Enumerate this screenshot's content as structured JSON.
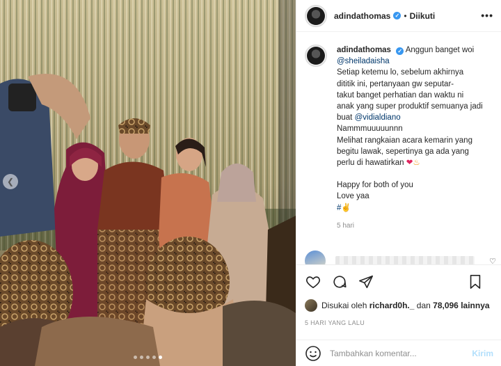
{
  "post": {
    "username": "adindathomas",
    "follow_status": "Diikuti",
    "separator": "•",
    "more_icon": "more-horizontal-icon"
  },
  "caption": {
    "username": "adindathomas",
    "lines": [
      "Anggun banget woi",
      "@sheiladaisha",
      "Setiap ketemu lo, sebelum akhirnya",
      "dititik ini, pertanyaan gw seputar-",
      "takut banget perhatian dan waktu ni",
      "anak yang super produktif semuanya jadi",
      "buat",
      "@vidialdiano",
      "Nammmuuuuunnn",
      "Melihat rangkaian acara kemarin yang",
      "begitu lawak, sepertinya ga ada yang",
      "perlu di hawatirkan",
      "Happy for both of you",
      "Love yaa",
      "#"
    ],
    "time": "5 hari"
  },
  "likes": {
    "prefix": "Disukai oleh",
    "user": "richard0h._",
    "connector": "dan",
    "count": "78,096",
    "suffix": "lainnya"
  },
  "timestamp": "5 HARI YANG LALU",
  "add_comment": {
    "placeholder": "Tambahkan komentar...",
    "send_label": "Kirim"
  },
  "carousel": {
    "total": 5,
    "active": 5
  },
  "colors": {
    "link": "#00376b",
    "verified": "#3897f0",
    "send_disabled": "#b2dffc",
    "muted": "#8e8e8e"
  }
}
